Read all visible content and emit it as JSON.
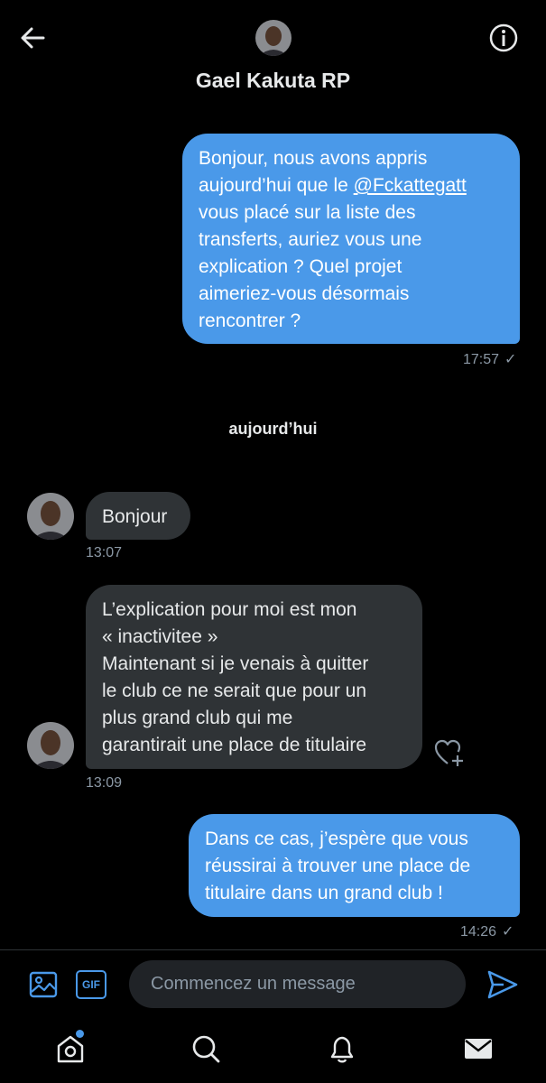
{
  "header": {
    "title": "Gael Kakuta RP",
    "back_icon": "arrow-left-icon",
    "info_icon": "info-circle-icon"
  },
  "messages": {
    "m1": {
      "lines": [
        "Bonjour, nous avons appris",
        "aujourd’hui que le ",
        "vous placé sur la liste des",
        "transferts, auriez vous une",
        "explication ? Quel projet",
        "aimeriez-vous désormais",
        "rencontrer ?"
      ],
      "mention": "@Fckattegatt",
      "time": "17:57"
    },
    "day_separator": "aujourd’hui",
    "m2": {
      "text": "Bonjour",
      "time": "13:07"
    },
    "m3": {
      "lines": [
        "L’explication pour moi est mon",
        "« inactivitee »",
        "Maintenant si je venais à quitter",
        "le club ce ne serait que pour un",
        "plus grand club qui me",
        "garantirait une place de titulaire"
      ],
      "time": "13:09"
    },
    "m4": {
      "lines": [
        "Dans ce cas, j’espère que vous",
        "réussirai à trouver une place de",
        "titulaire dans un grand club !"
      ],
      "time": "14:26"
    }
  },
  "composer": {
    "placeholder": "Commencez un message",
    "gif_label": "GIF"
  },
  "read_check": "✓",
  "colors": {
    "accent": "#4a99e9",
    "incoming_bubble": "#2f3336",
    "background": "#000000"
  },
  "nav": [
    "home-icon",
    "search-icon",
    "bell-icon",
    "mail-icon"
  ]
}
